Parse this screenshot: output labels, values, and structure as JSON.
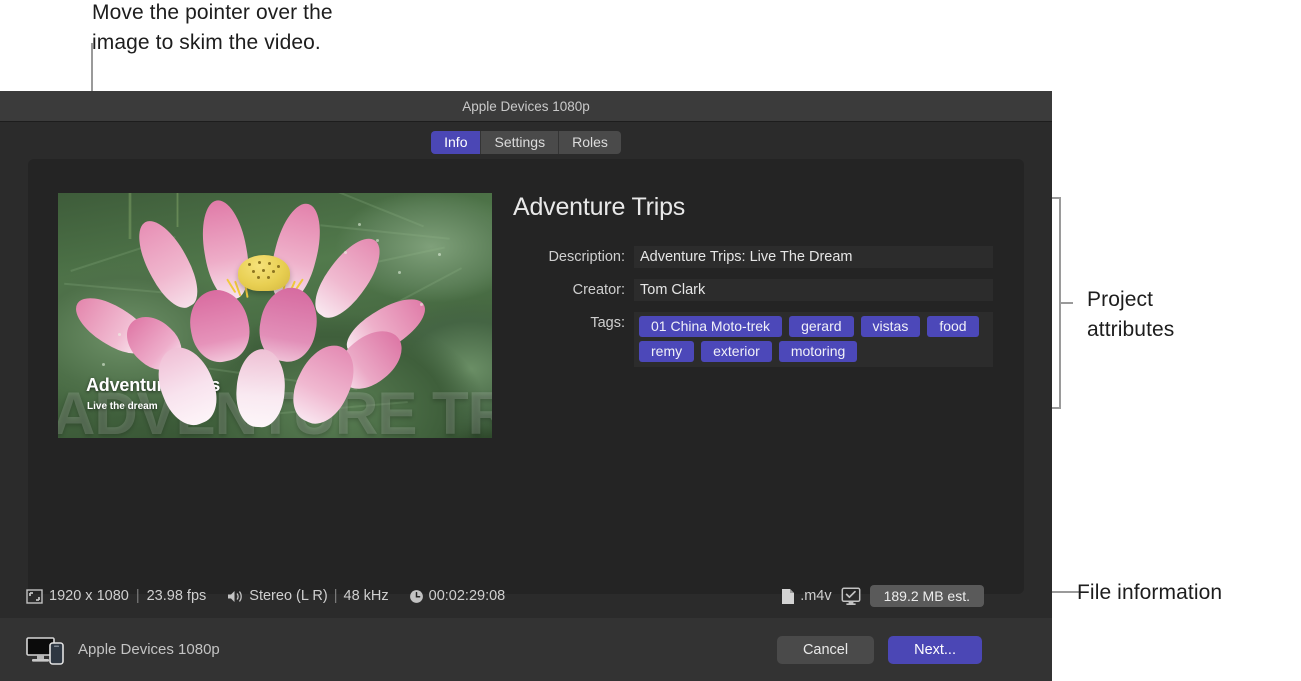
{
  "callouts": {
    "skim": "Move the pointer over the\nimage to skim the video.",
    "project_attributes": "Project\nattributes",
    "file_information": "File information"
  },
  "window": {
    "title": "Apple Devices 1080p",
    "tabs": [
      {
        "label": "Info",
        "active": true
      },
      {
        "label": "Settings",
        "active": false
      },
      {
        "label": "Roles",
        "active": false
      }
    ]
  },
  "thumbnail": {
    "watermark": "ADVENTURE TRIPS",
    "overlay_title": "Adventure Trips",
    "overlay_subtitle": "Live the dream",
    "icon": "video-thumbnail"
  },
  "attributes": {
    "project_title": "Adventure Trips",
    "description_label": "Description:",
    "description_value": "Adventure Trips: Live The Dream",
    "creator_label": "Creator:",
    "creator_value": "Tom Clark",
    "tags_label": "Tags:",
    "tags": [
      "01 China Moto-trek",
      "gerard",
      "vistas",
      "food",
      "remy",
      "exterior",
      "motoring"
    ],
    "tag_color": "#4c48b9"
  },
  "file_info": {
    "resolution": "1920 x 1080",
    "framerate": "23.98 fps",
    "audio": "Stereo (L R)",
    "samplerate": "48 kHz",
    "duration": "00:02:29:08",
    "extension": ".m4v",
    "size_estimate": "189.2 MB est.",
    "separator": "|",
    "icons": {
      "frame": "frame-size-icon",
      "speaker": "speaker-icon",
      "clock": "clock-icon",
      "document": "document-icon",
      "monitor_check": "monitor-check-icon"
    }
  },
  "bottom_bar": {
    "device_name": "Apple Devices 1080p",
    "device_icon": "display-and-phone-icon",
    "cancel_label": "Cancel",
    "next_label": "Next...",
    "accent_color": "#4b47b5"
  }
}
